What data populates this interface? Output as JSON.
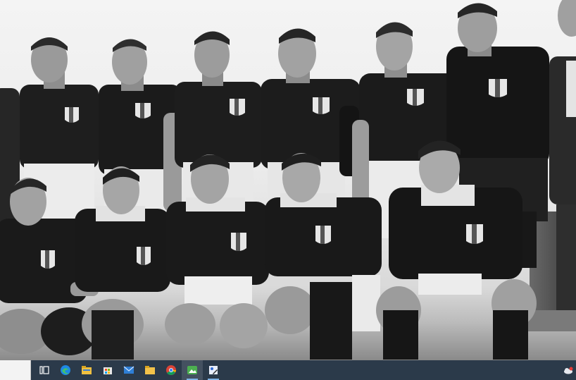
{
  "photo": {
    "description_icon": "team-photo",
    "style": "black-and-white"
  },
  "taskbar": {
    "search_placeholder": "",
    "apps": [
      {
        "icon": "task-view-icon"
      },
      {
        "icon": "edge-icon"
      },
      {
        "icon": "file-explorer-icon"
      },
      {
        "icon": "store-icon"
      },
      {
        "icon": "mail-icon"
      },
      {
        "icon": "folder-icon"
      },
      {
        "icon": "chrome-icon"
      },
      {
        "icon": "photos-app-icon"
      },
      {
        "icon": "paint-app-icon"
      }
    ],
    "tray": [
      {
        "icon": "weather-icon"
      }
    ]
  },
  "colors": {
    "taskbar": "#2b3a4a",
    "accent": "#7fb4e6"
  }
}
